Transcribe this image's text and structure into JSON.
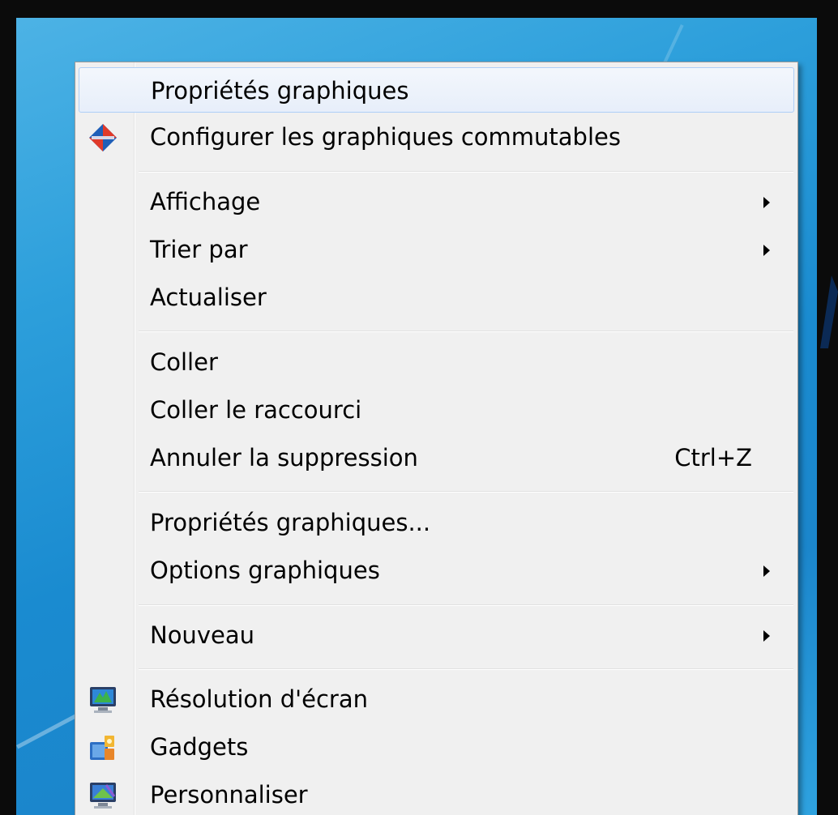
{
  "menu": {
    "items": [
      {
        "label": "Propriétés graphiques"
      },
      {
        "label": "Configurer les graphiques commutables"
      },
      {
        "label": "Affichage"
      },
      {
        "label": "Trier par"
      },
      {
        "label": "Actualiser"
      },
      {
        "label": "Coller"
      },
      {
        "label": "Coller le raccourci"
      },
      {
        "label": "Annuler la suppression",
        "shortcut": "Ctrl+Z"
      },
      {
        "label": "Propriétés graphiques..."
      },
      {
        "label": "Options graphiques"
      },
      {
        "label": "Nouveau"
      },
      {
        "label": "Résolution d'écran"
      },
      {
        "label": "Gadgets"
      },
      {
        "label": "Personnaliser"
      }
    ]
  },
  "colors": {
    "menu_background": "#f0f0f0",
    "hover_border": "#aecff7",
    "desktop_blue": "#1a8bd0"
  },
  "icons": [
    "switchable-graphics-icon",
    "screen-resolution-icon",
    "gadgets-icon",
    "personalize-icon"
  ]
}
